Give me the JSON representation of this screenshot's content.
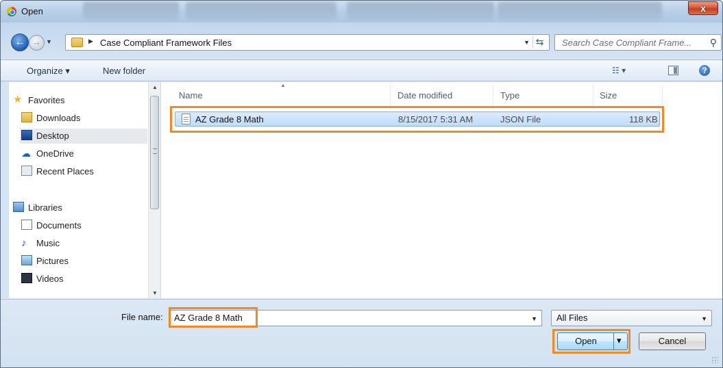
{
  "window": {
    "title": "Open",
    "close_label": "x"
  },
  "address": {
    "folder": "Case Compliant Framework Files"
  },
  "search": {
    "placeholder": "Search Case Compliant Frame..."
  },
  "toolbar": {
    "organize_label": "Organize ▾",
    "new_folder_label": "New folder",
    "help_label": "?"
  },
  "nav": {
    "favorites": "Favorites",
    "favorite_items": [
      "Downloads",
      "Desktop",
      "OneDrive",
      "Recent Places"
    ],
    "libraries": "Libraries",
    "library_items": [
      "Documents",
      "Music",
      "Pictures",
      "Videos"
    ],
    "selected": "Desktop"
  },
  "columns": {
    "name": "Name",
    "date": "Date modified",
    "type": "Type",
    "size": "Size"
  },
  "files": [
    {
      "name": "AZ Grade 8 Math",
      "date": "8/15/2017 5:31 AM",
      "type": "JSON File",
      "size": "118 KB"
    }
  ],
  "bottom": {
    "file_name_label": "File name:",
    "file_name_value": "AZ Grade 8 Math",
    "file_type_value": "All Files",
    "open_label": "Open",
    "cancel_label": "Cancel"
  },
  "colors": {
    "highlight": "#f08a24",
    "selection": "#c1dcfc"
  }
}
